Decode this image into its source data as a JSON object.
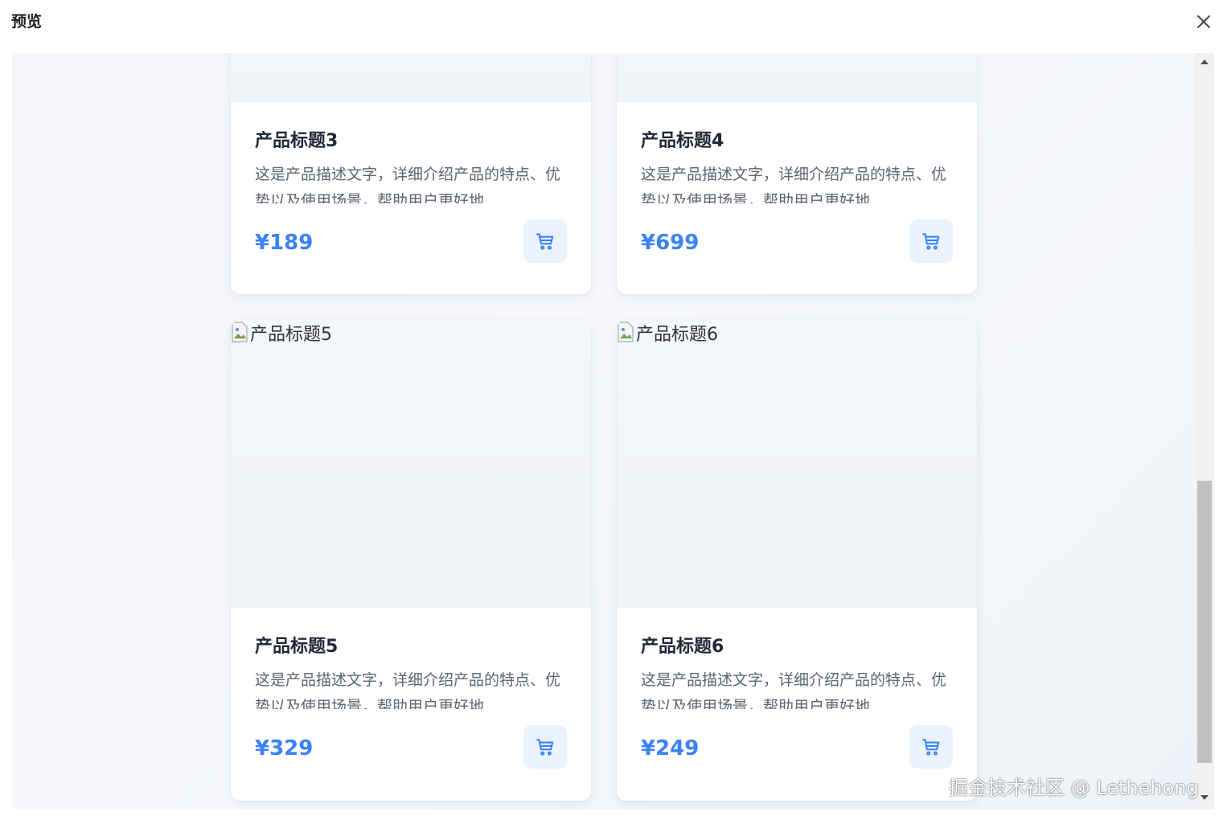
{
  "dialog": {
    "title": "预览"
  },
  "products": [
    {
      "image_alt": "",
      "title": "产品标题3",
      "description": "这是产品描述文字，详细介绍产品的特点、优势以及使用场景，帮助用户更好地",
      "price": "¥189"
    },
    {
      "image_alt": "",
      "title": "产品标题4",
      "description": "这是产品描述文字，详细介绍产品的特点、优势以及使用场景，帮助用户更好地",
      "price": "¥699"
    },
    {
      "image_alt": "产品标题5",
      "title": "产品标题5",
      "description": "这是产品描述文字，详细介绍产品的特点、优势以及使用场景，帮助用户更好地",
      "price": "¥329"
    },
    {
      "image_alt": "产品标题6",
      "title": "产品标题6",
      "description": "这是产品描述文字，详细介绍产品的特点、优势以及使用场景，帮助用户更好地",
      "price": "¥249"
    }
  ],
  "watermark": "掘金技术社区 @ Lethehong",
  "icons": {
    "close": "close-icon",
    "cart": "shopping-cart-icon",
    "broken_image": "broken-image-icon",
    "scroll_up": "triangle-up-icon",
    "scroll_down": "triangle-down-icon"
  },
  "colors": {
    "price": "#3b82f6",
    "cart_bg": "#eaf2fd",
    "scroll_thumb": "#c1c1c1"
  }
}
